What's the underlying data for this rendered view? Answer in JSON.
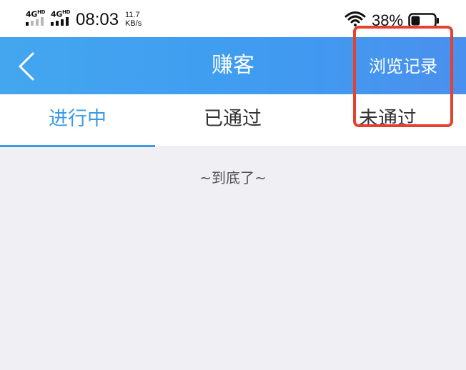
{
  "status_bar": {
    "signal_1": "4G",
    "signal_1_sup": "HD",
    "signal_2": "4G",
    "signal_2_sup": "HD",
    "time": "08:03",
    "speed_value": "11.7",
    "speed_unit": "KB/s",
    "battery": "38%",
    "battery_level": 0.38,
    "icons": [
      "wifi-icon",
      "battery-icon"
    ]
  },
  "nav": {
    "back_icon": "chevron-left-icon",
    "title": "赚客",
    "right_action": "浏览记录"
  },
  "tabs": [
    {
      "label": "进行中",
      "active": true
    },
    {
      "label": "已通过",
      "active": false
    },
    {
      "label": "未通过",
      "active": false
    }
  ],
  "content": {
    "end_text": "~到底了~"
  },
  "colors": {
    "nav_bg": "#409ef0",
    "accent": "#3a9ae6",
    "page_bg": "#f0eff4",
    "highlight": "#e5412f"
  }
}
